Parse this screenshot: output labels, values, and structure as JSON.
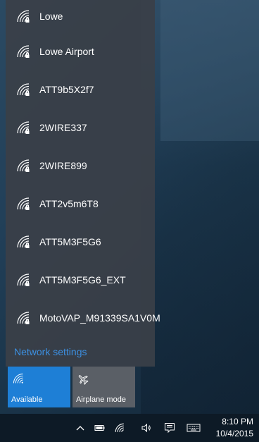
{
  "networks": [
    {
      "name": "Lowe",
      "icon": "wifi-secured-icon"
    },
    {
      "name": "Lowe Airport",
      "icon": "wifi-secured-icon"
    },
    {
      "name": "ATT9b5X2f7",
      "icon": "wifi-secured-icon"
    },
    {
      "name": "2WIRE337",
      "icon": "wifi-secured-icon"
    },
    {
      "name": "2WIRE899",
      "icon": "wifi-secured-icon"
    },
    {
      "name": "ATT2v5m6T8",
      "icon": "wifi-secured-icon"
    },
    {
      "name": "ATT5M3F5G6",
      "icon": "wifi-secured-icon"
    },
    {
      "name": "ATT5M3F5G6_EXT",
      "icon": "wifi-secured-icon"
    },
    {
      "name": "MotoVAP_M91339SA1V0M",
      "icon": "wifi-secured-icon"
    }
  ],
  "network_settings_label": "Network settings",
  "quick_actions": {
    "wifi": {
      "label": "Available",
      "icon": "wifi-icon",
      "color": "#1e7fd6"
    },
    "airplane": {
      "label": "Airplane mode",
      "icon": "airplane-icon",
      "color": "#5a5f66"
    }
  },
  "taskbar": {
    "tray_icons": [
      "chevron-up-icon",
      "battery-icon",
      "wifi-icon",
      "volume-icon",
      "action-center-icon",
      "keyboard-icon"
    ],
    "time": "8:10 PM",
    "date": "10/4/2015"
  },
  "colors": {
    "accent": "#1e7fd6",
    "link": "#3c8fe0",
    "flyout": "#3a4048",
    "taskbar": "#0d1a26"
  }
}
